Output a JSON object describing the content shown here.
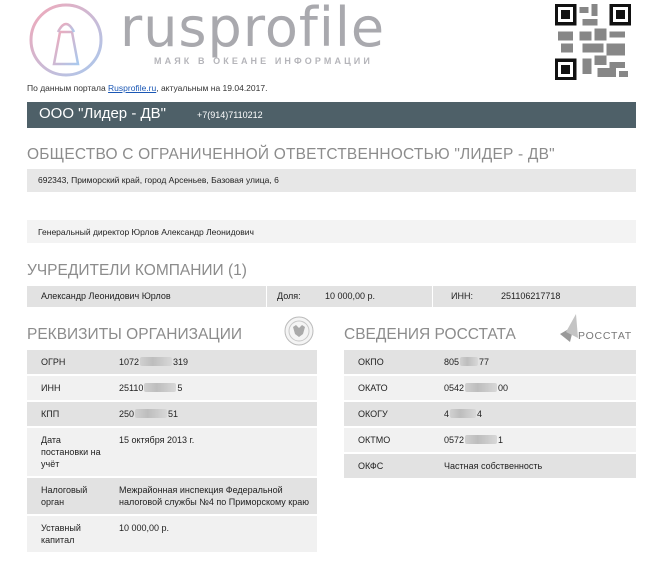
{
  "logo": {
    "wordmark": "rusprofile",
    "tagline": "МАЯК В ОКЕАНЕ ИНФОРМАЦИИ"
  },
  "source": {
    "prefix": "По данным портала ",
    "link": "Rusprofile.ru",
    "suffix": ", актуальным на 19.04.2017."
  },
  "company": {
    "short_name": "ООО \"Лидер - ДВ\"",
    "phone": "+7(914)7110212"
  },
  "full_name": "ОБЩЕСТВО С ОГРАНИЧЕННОЙ ОТВЕТСТВЕННОСТЬЮ \"ЛИДЕР - ДВ\"",
  "address": "692343, Приморский край, город Арсеньев, Базовая улица, 6",
  "director": "Генеральный директор Юрлов Александр Леонидович",
  "founders": {
    "title": "УЧРЕДИТЕЛИ КОМПАНИИ (1)",
    "name": "Александр Леонидович Юрлов",
    "share_label": "Доля:",
    "share_value": "10 000,00 р.",
    "inn_label": "ИНН:",
    "inn_value": "251106217718"
  },
  "requisites": {
    "title": "РЕКВИЗИТЫ ОРГАНИЗАЦИИ",
    "rows": [
      {
        "label": "ОГРН",
        "value_start": "1072",
        "value_end": "319"
      },
      {
        "label": "ИНН",
        "value_start": "25110",
        "value_end": "5"
      },
      {
        "label": "КПП",
        "value_start": "250",
        "value_end": "51"
      },
      {
        "label": "Дата постановки на учёт",
        "value": "15 октября 2013 г."
      },
      {
        "label": "Налоговый орган",
        "value": "Межрайонная инспекция Федеральной налоговой службы №4 по Приморскому краю"
      },
      {
        "label": "Уставный капитал",
        "value": "10 000,00 р."
      }
    ]
  },
  "rosstat": {
    "title": "СВЕДЕНИЯ РОССТАТА",
    "logo_text": "РОССТАТ",
    "rows": [
      {
        "label": "ОКПО",
        "value_start": "805",
        "value_end": "77"
      },
      {
        "label": "ОКАТО",
        "value_start": "0542",
        "value_end": "00"
      },
      {
        "label": "ОКОГУ",
        "value_start": "4",
        "value_end": "4"
      },
      {
        "label": "ОКТМО",
        "value_start": "0572",
        "value_end": "1"
      },
      {
        "label": "ОКФС",
        "value": "Частная собственность"
      }
    ]
  },
  "colors": {
    "header_bar": "#4e6068",
    "section_title": "#8c8c8c",
    "row_dark": "#e2e2e2",
    "row_light": "#f1f1f1"
  }
}
